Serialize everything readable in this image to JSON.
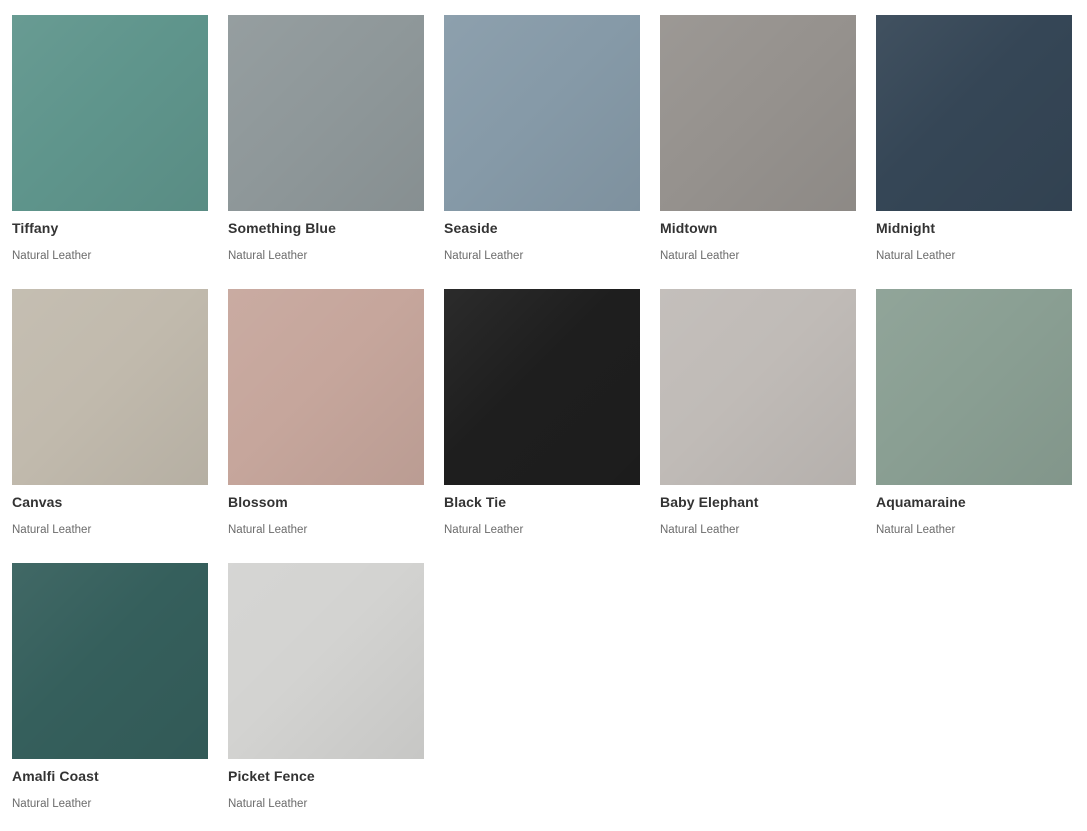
{
  "swatches": [
    {
      "name": "Tiffany",
      "material": "Natural Leather",
      "color": "#5f958c"
    },
    {
      "name": "Something Blue",
      "material": "Natural Leather",
      "color": "#8f989a"
    },
    {
      "name": "Seaside",
      "material": "Natural Leather",
      "color": "#869aa8"
    },
    {
      "name": "Midtown",
      "material": "Natural Leather",
      "color": "#96928e"
    },
    {
      "name": "Midnight",
      "material": "Natural Leather",
      "color": "#354656"
    },
    {
      "name": "Canvas",
      "material": "Natural Leather",
      "color": "#c1baad"
    },
    {
      "name": "Blossom",
      "material": "Natural Leather",
      "color": "#c6a69c"
    },
    {
      "name": "Black Tie",
      "material": "Natural Leather",
      "color": "#1e1e1e"
    },
    {
      "name": "Baby Elephant",
      "material": "Natural Leather",
      "color": "#c0bbb7"
    },
    {
      "name": "Aquamaraine",
      "material": "Natural Leather",
      "color": "#8a9f93"
    },
    {
      "name": "Amalfi Coast",
      "material": "Natural Leather",
      "color": "#355f5c"
    },
    {
      "name": "Picket Fence",
      "material": "Natural Leather",
      "color": "#d3d3d1"
    }
  ]
}
